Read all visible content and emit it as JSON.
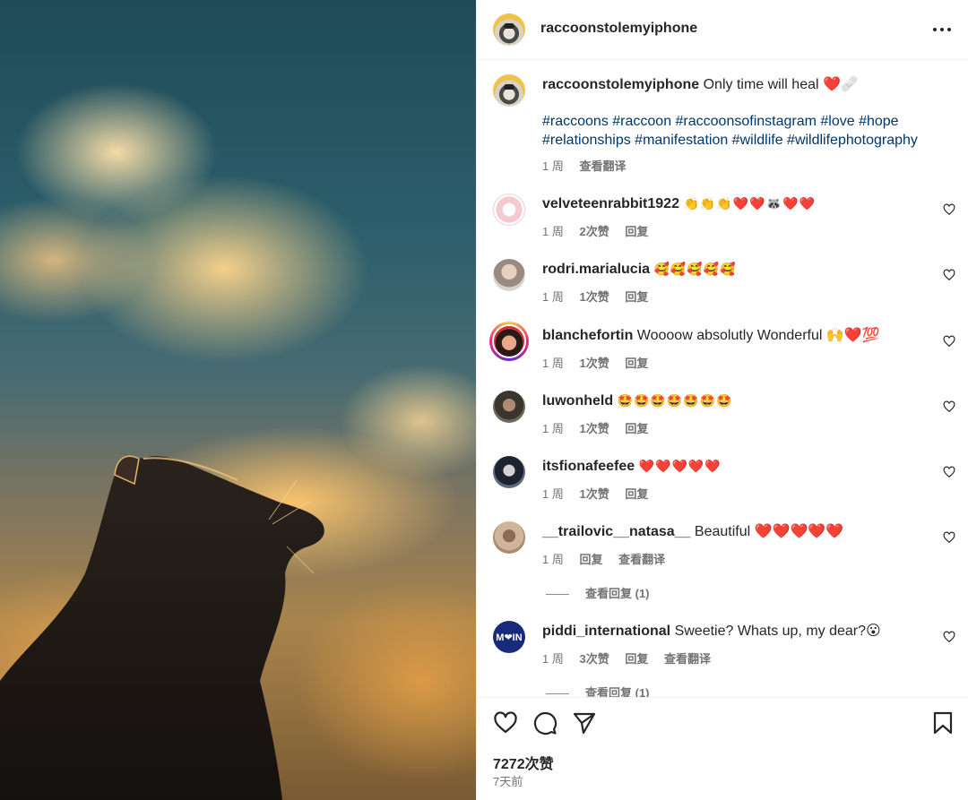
{
  "post": {
    "username": "raccoonstolemyiphone",
    "caption": "Only time will heal ❤️🩹",
    "hashtags_line1": "#raccoons #raccoon #raccoonsofinstagram #love #hope",
    "hashtags_line2": "#relationships #manifestation #wildlife #wildlifephotography",
    "caption_age": "1 周",
    "see_translation": "查看翻译",
    "likes": "7272次赞",
    "posted": "7天前"
  },
  "comments": [
    {
      "username": "velveteenrabbit1922",
      "text": "👏👏👏❤️❤️🦝❤️❤️",
      "age": "1 周",
      "likes": "2次赞",
      "reply": "回复"
    },
    {
      "username": "rodri.marialucia",
      "text": "🥰🥰🥰🥰🥰",
      "age": "1 周",
      "likes": "1次赞",
      "reply": "回复"
    },
    {
      "username": "blanchefortin",
      "text": "Woooow absolutly Wonderful 🙌❤️💯",
      "age": "1 周",
      "likes": "1次赞",
      "reply": "回复"
    },
    {
      "username": "luwonheld",
      "text": "🤩🤩🤩🤩🤩🤩🤩",
      "age": "1 周",
      "likes": "1次赞",
      "reply": "回复"
    },
    {
      "username": "itsfionafeefee",
      "text": "❤️❤️❤️❤️❤️",
      "age": "1 周",
      "likes": "1次赞",
      "reply": "回复"
    },
    {
      "username": "__trailovic__natasa__",
      "text": "Beautiful ❤️❤️❤️❤️❤️",
      "age": "1 周",
      "reply": "回复",
      "translate": "查看翻译",
      "view_replies": "查看回复 (1)"
    },
    {
      "username": "piddi_international",
      "text": "Sweetie? Whats up, my dear?😮",
      "age": "1 周",
      "likes": "3次赞",
      "reply": "回复",
      "translate": "查看翻译",
      "view_replies": "查看回复 (1)",
      "avatar_text": "M❤IN"
    }
  ],
  "icons": {
    "more": "more-options-icon",
    "like": "heart-icon",
    "comment": "comment-bubble-icon",
    "share": "paper-plane-icon",
    "save": "bookmark-icon"
  }
}
